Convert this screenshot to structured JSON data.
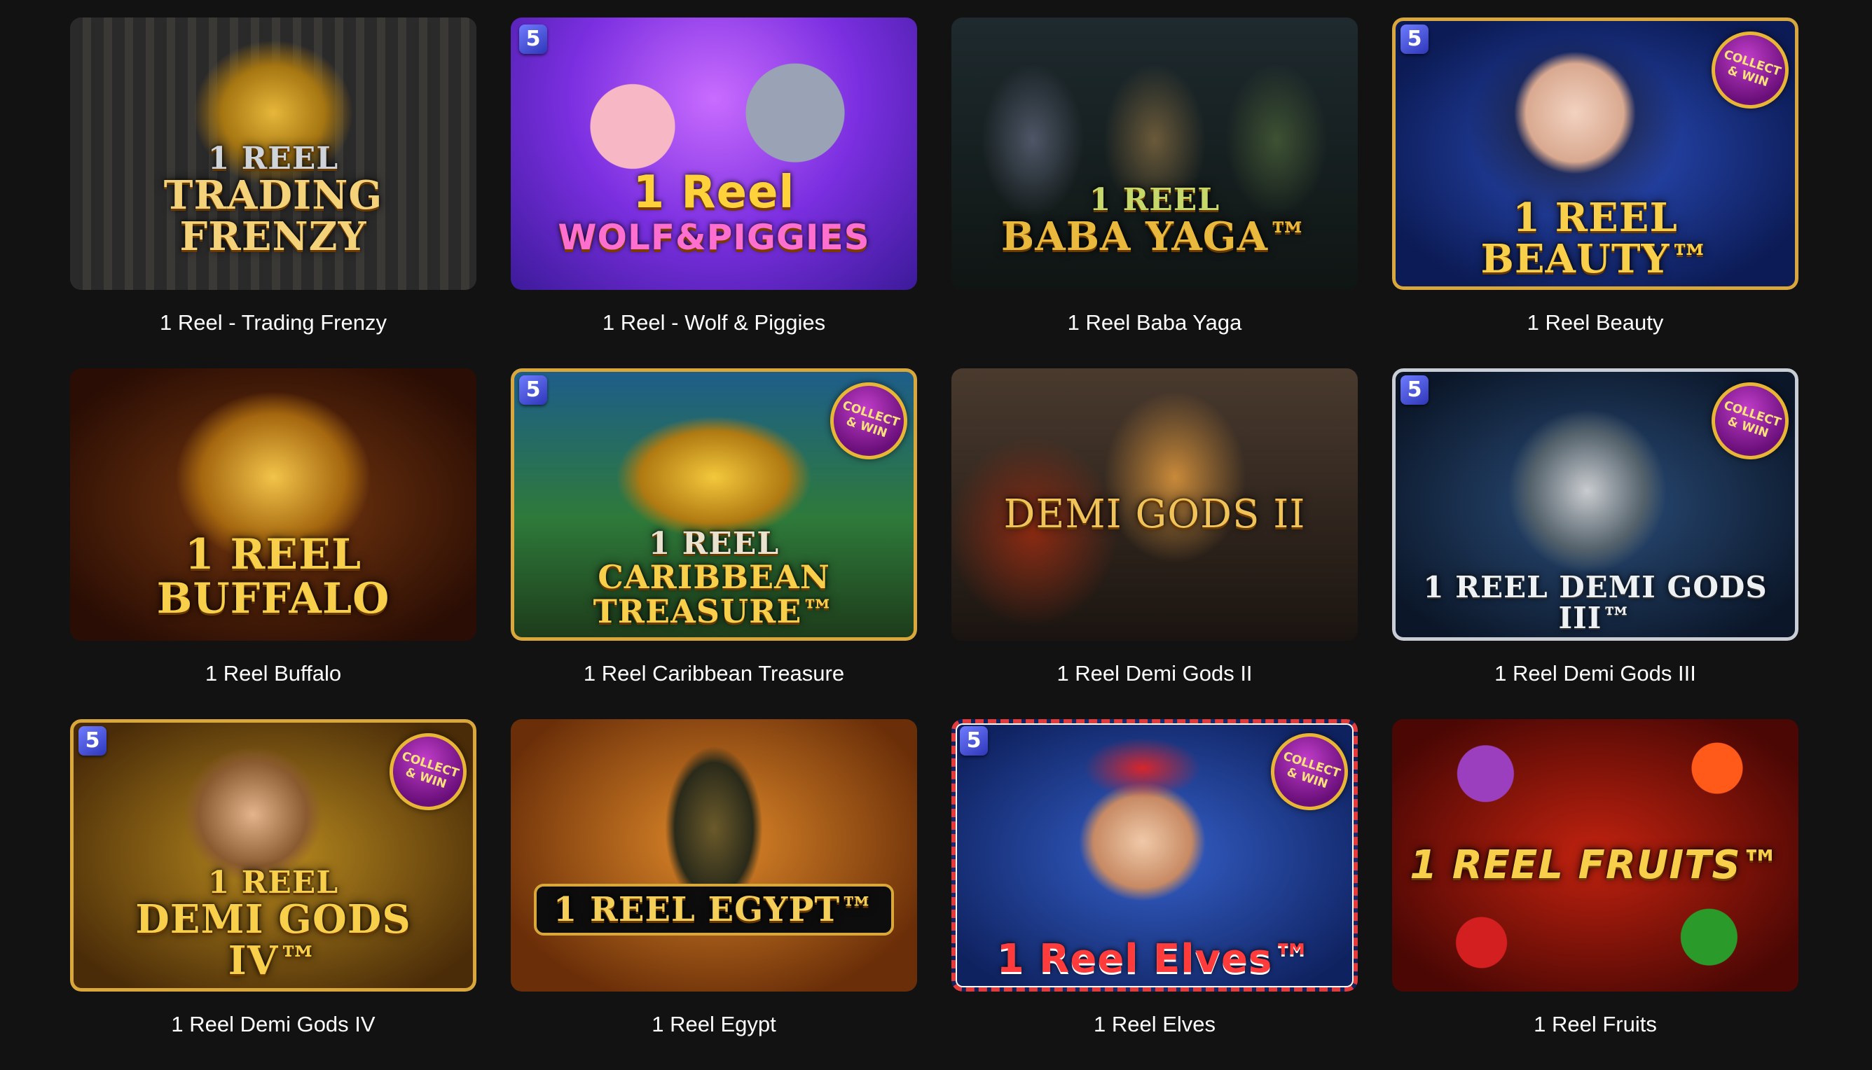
{
  "games": [
    {
      "title": "1 Reel - Trading Frenzy",
      "logo_top": "1 REEL",
      "logo_main": "TRADING FRENZY",
      "provider_badge": "",
      "collect_badge": ""
    },
    {
      "title": "1 Reel - Wolf & Piggies",
      "logo_top": "1 Reel",
      "logo_main": "WOLF&PIGGIES",
      "provider_badge": "5",
      "collect_badge": ""
    },
    {
      "title": "1 Reel Baba Yaga",
      "logo_top": "1 REEL",
      "logo_main": "BABA YAGA™",
      "provider_badge": "",
      "collect_badge": ""
    },
    {
      "title": "1 Reel Beauty",
      "logo_top": "",
      "logo_main": "1 REEL BEAUTY™",
      "provider_badge": "5",
      "collect_badge": "COLLECT & WIN"
    },
    {
      "title": "1 Reel Buffalo",
      "logo_top": "",
      "logo_main": "1 REEL BUFFALO",
      "provider_badge": "",
      "collect_badge": ""
    },
    {
      "title": "1 Reel Caribbean Treasure",
      "logo_top": "1 REEL",
      "logo_main": "CARIBBEAN TREASURE™",
      "provider_badge": "5",
      "collect_badge": "COLLECT & WIN"
    },
    {
      "title": "1 Reel Demi Gods II",
      "logo_top": "",
      "logo_main": "DEMI GODS II",
      "provider_badge": "",
      "collect_badge": ""
    },
    {
      "title": "1 Reel Demi Gods III",
      "logo_top": "",
      "logo_main": "1 REEL DEMI GODS III™",
      "provider_badge": "5",
      "collect_badge": "COLLECT & WIN"
    },
    {
      "title": "1 Reel Demi Gods IV",
      "logo_top": "1 REEL",
      "logo_main": "DEMI GODS IV™",
      "provider_badge": "5",
      "collect_badge": "COLLECT & WIN"
    },
    {
      "title": "1 Reel Egypt",
      "logo_top": "",
      "logo_main": "1 REEL EGYPT™",
      "provider_badge": "",
      "collect_badge": ""
    },
    {
      "title": "1 Reel Elves",
      "logo_top": "",
      "logo_main": "1 Reel Elves™",
      "provider_badge": "5",
      "collect_badge": "COLLECT & WIN"
    },
    {
      "title": "1 Reel Fruits",
      "logo_top": "",
      "logo_main": "1 REEL FRUITS™",
      "provider_badge": "",
      "collect_badge": ""
    }
  ],
  "colors": {
    "page_bg": "#121212",
    "title_text": "#ffffff",
    "logo_gold": "#f7cf4a"
  }
}
